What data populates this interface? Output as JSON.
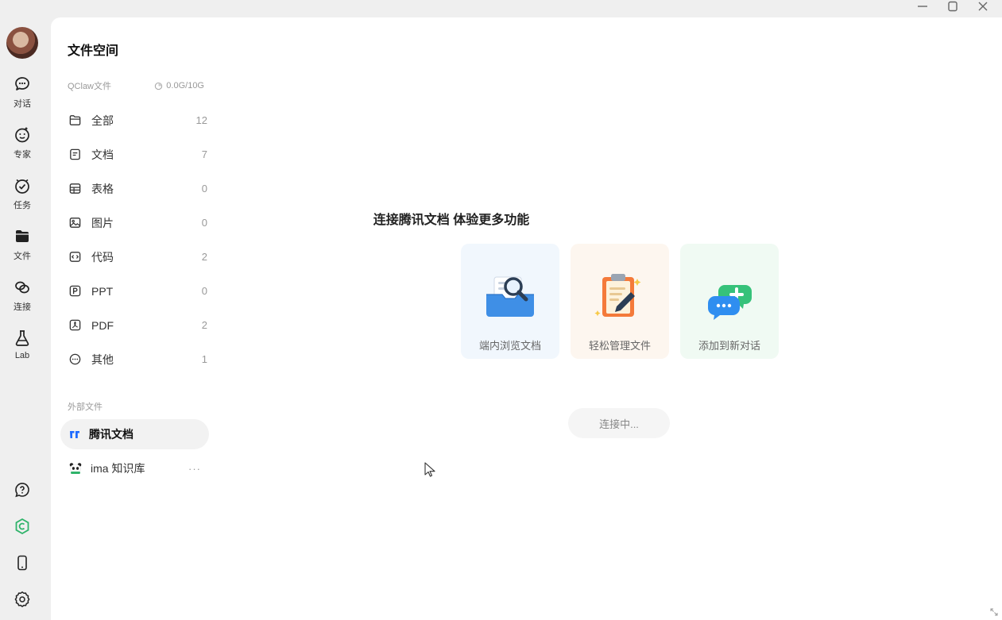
{
  "rail": {
    "items": [
      {
        "label": "对话",
        "icon": "chat-icon"
      },
      {
        "label": "专家",
        "icon": "expert-icon"
      },
      {
        "label": "任务",
        "icon": "task-clock-icon"
      },
      {
        "label": "文件",
        "icon": "folder-icon"
      },
      {
        "label": "连接",
        "icon": "link-icon"
      },
      {
        "label": "Lab",
        "icon": "flask-icon"
      }
    ],
    "bottom": [
      "help-icon",
      "brand-c-icon",
      "phone-icon",
      "settings-icon"
    ]
  },
  "sidebar": {
    "title": "文件空间",
    "section_label": "QClaw文件",
    "storage": "0.0G/10G",
    "categories": [
      {
        "label": "全部",
        "count": "12",
        "icon": "folder-outline-icon"
      },
      {
        "label": "文档",
        "count": "7",
        "icon": "document-icon"
      },
      {
        "label": "表格",
        "count": "0",
        "icon": "table-icon"
      },
      {
        "label": "图片",
        "count": "0",
        "icon": "image-icon"
      },
      {
        "label": "代码",
        "count": "2",
        "icon": "code-icon"
      },
      {
        "label": "PPT",
        "count": "0",
        "icon": "ppt-icon"
      },
      {
        "label": "PDF",
        "count": "2",
        "icon": "pdf-icon"
      },
      {
        "label": "其他",
        "count": "1",
        "icon": "more-circle-icon"
      }
    ],
    "external_title": "外部文件",
    "external": [
      {
        "label": "腾讯文档",
        "icon": "tencent-docs-icon"
      },
      {
        "label": "ima 知识库",
        "icon": "ima-panda-icon",
        "more": "···"
      }
    ]
  },
  "content": {
    "title": "连接腾讯文档 体验更多功能",
    "cards": [
      {
        "label": "端内浏览文档",
        "icon": "browse-doc-icon"
      },
      {
        "label": "轻松管理文件",
        "icon": "clipboard-manage-icon"
      },
      {
        "label": "添加到新对话",
        "icon": "add-chat-icon"
      }
    ],
    "connect_button": "连接中..."
  },
  "colors": {
    "accent_blue": "#1e6bff",
    "brand_green": "#2fb36a",
    "background": "#efefef"
  }
}
